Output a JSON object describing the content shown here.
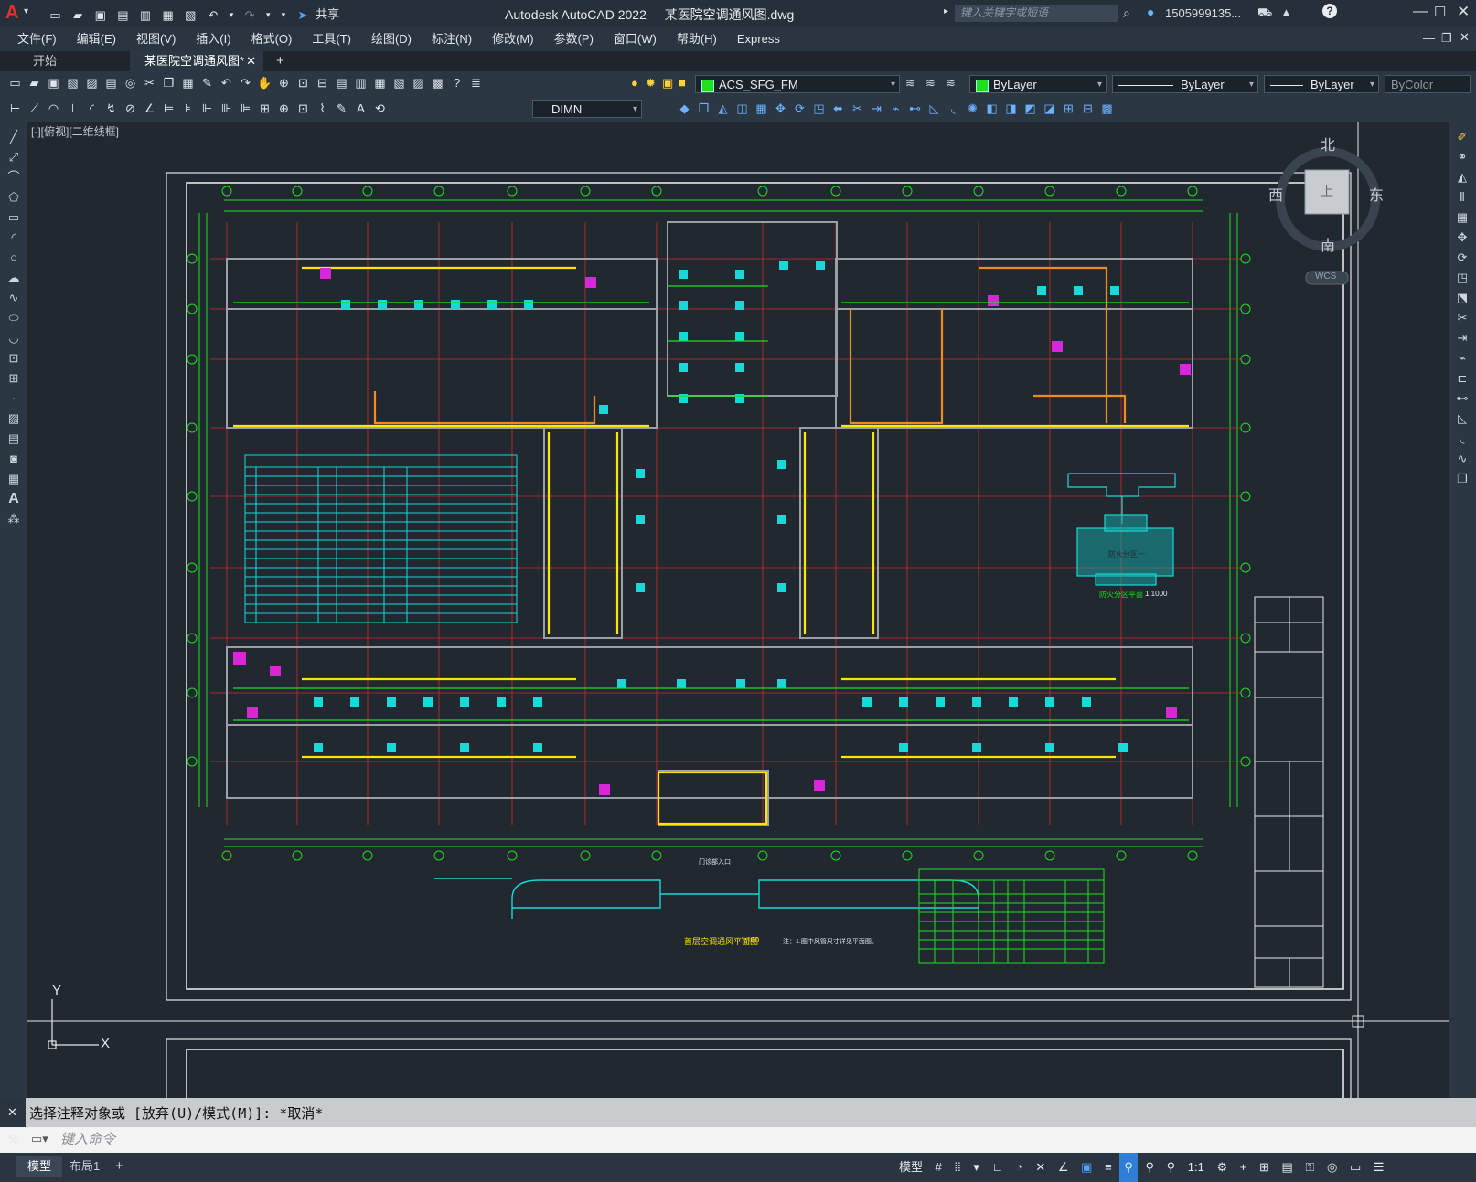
{
  "app": {
    "title": "Autodesk AutoCAD 2022",
    "filename": "某医院空调通风图.dwg",
    "share_label": "共享",
    "search_placeholder": "键入关键字或短语",
    "user": "1505999135...",
    "accent": "#1fdf1f"
  },
  "menu": [
    "文件(F)",
    "编辑(E)",
    "视图(V)",
    "插入(I)",
    "格式(O)",
    "工具(T)",
    "绘图(D)",
    "标注(N)",
    "修改(M)",
    "参数(P)",
    "窗口(W)",
    "帮助(H)",
    "Express"
  ],
  "tabs": {
    "start": "开始",
    "active": "某医院空调通风图*",
    "add": "+"
  },
  "ribbon": {
    "layer": "ACS_SFG_FM",
    "color": "ByLayer",
    "linetype": "ByLayer",
    "lineweight": "ByLayer",
    "plotstyle": "ByColor",
    "dimstyle": "DIMN"
  },
  "viewport": {
    "label": "[-][俯视][二维线框]",
    "cube": {
      "north": "北",
      "south": "南",
      "east": "东",
      "west": "西",
      "top": "上",
      "wcs": "WCS"
    },
    "ucs": {
      "x": "X",
      "y": "Y"
    }
  },
  "drawing": {
    "plan_title": "首层空调通风平面图",
    "plan_scale": "1:100",
    "fire_title": "防火分区平面",
    "fire_scale": "1:1000",
    "fire_label": "防火分区一",
    "entrance": "门诊部入口",
    "notes": "注：1.图中风管尺寸详见平面图。"
  },
  "command": {
    "history": "选择注释对象或 [放弃(U)/模式(M)]: *取消*",
    "placeholder": "键入命令"
  },
  "layouts": [
    "模型",
    "布局1",
    "+"
  ],
  "status": {
    "model": "模型",
    "scale": "1:1"
  }
}
